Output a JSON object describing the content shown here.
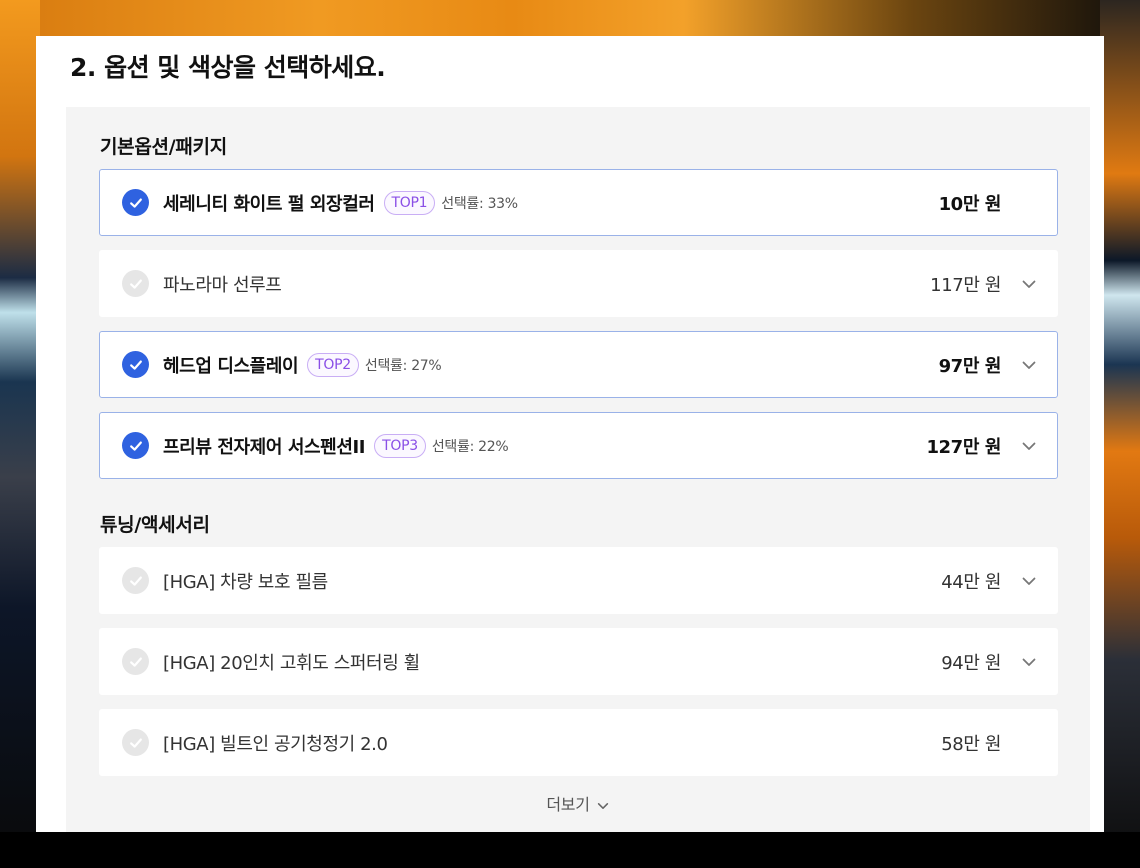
{
  "section": {
    "title": "2. 옵션 및 색상을 선택하세요."
  },
  "groups": [
    {
      "title": "기본옵션/패키지",
      "items": [
        {
          "name": "세레니티 화이트 펄 외장컬러",
          "badge": "TOP1",
          "rate": "선택률: 33%",
          "price_num": "10",
          "price_unit": "만 원",
          "selected": true,
          "expandable": false
        },
        {
          "name": "파노라마 선루프",
          "badge": "",
          "rate": "",
          "price_num": "117",
          "price_unit": "만 원",
          "selected": false,
          "expandable": true
        },
        {
          "name": "헤드업 디스플레이",
          "badge": "TOP2",
          "rate": "선택률: 27%",
          "price_num": "97",
          "price_unit": "만 원",
          "selected": true,
          "expandable": true
        },
        {
          "name": "프리뷰 전자제어 서스펜션II",
          "badge": "TOP3",
          "rate": "선택률: 22%",
          "price_num": "127",
          "price_unit": "만 원",
          "selected": true,
          "expandable": true
        }
      ]
    },
    {
      "title": "튜닝/액세서리",
      "items": [
        {
          "name": "[HGA] 차량 보호 필름",
          "badge": "",
          "rate": "",
          "price_num": "44",
          "price_unit": "만 원",
          "selected": false,
          "expandable": true
        },
        {
          "name": "[HGA] 20인치 고휘도 스퍼터링 휠",
          "badge": "",
          "rate": "",
          "price_num": "94",
          "price_unit": "만 원",
          "selected": false,
          "expandable": true
        },
        {
          "name": "[HGA] 빌트인 공기청정기 2.0",
          "badge": "",
          "rate": "",
          "price_num": "58",
          "price_unit": "만 원",
          "selected": false,
          "expandable": false
        }
      ]
    }
  ],
  "more_label": "더보기",
  "icons": {
    "check": "check-icon",
    "chevron": "chevron-down-icon"
  },
  "colors": {
    "accent": "#2f62e0",
    "badge": "#8a4fe6",
    "selected_border": "#9ab2e8"
  }
}
